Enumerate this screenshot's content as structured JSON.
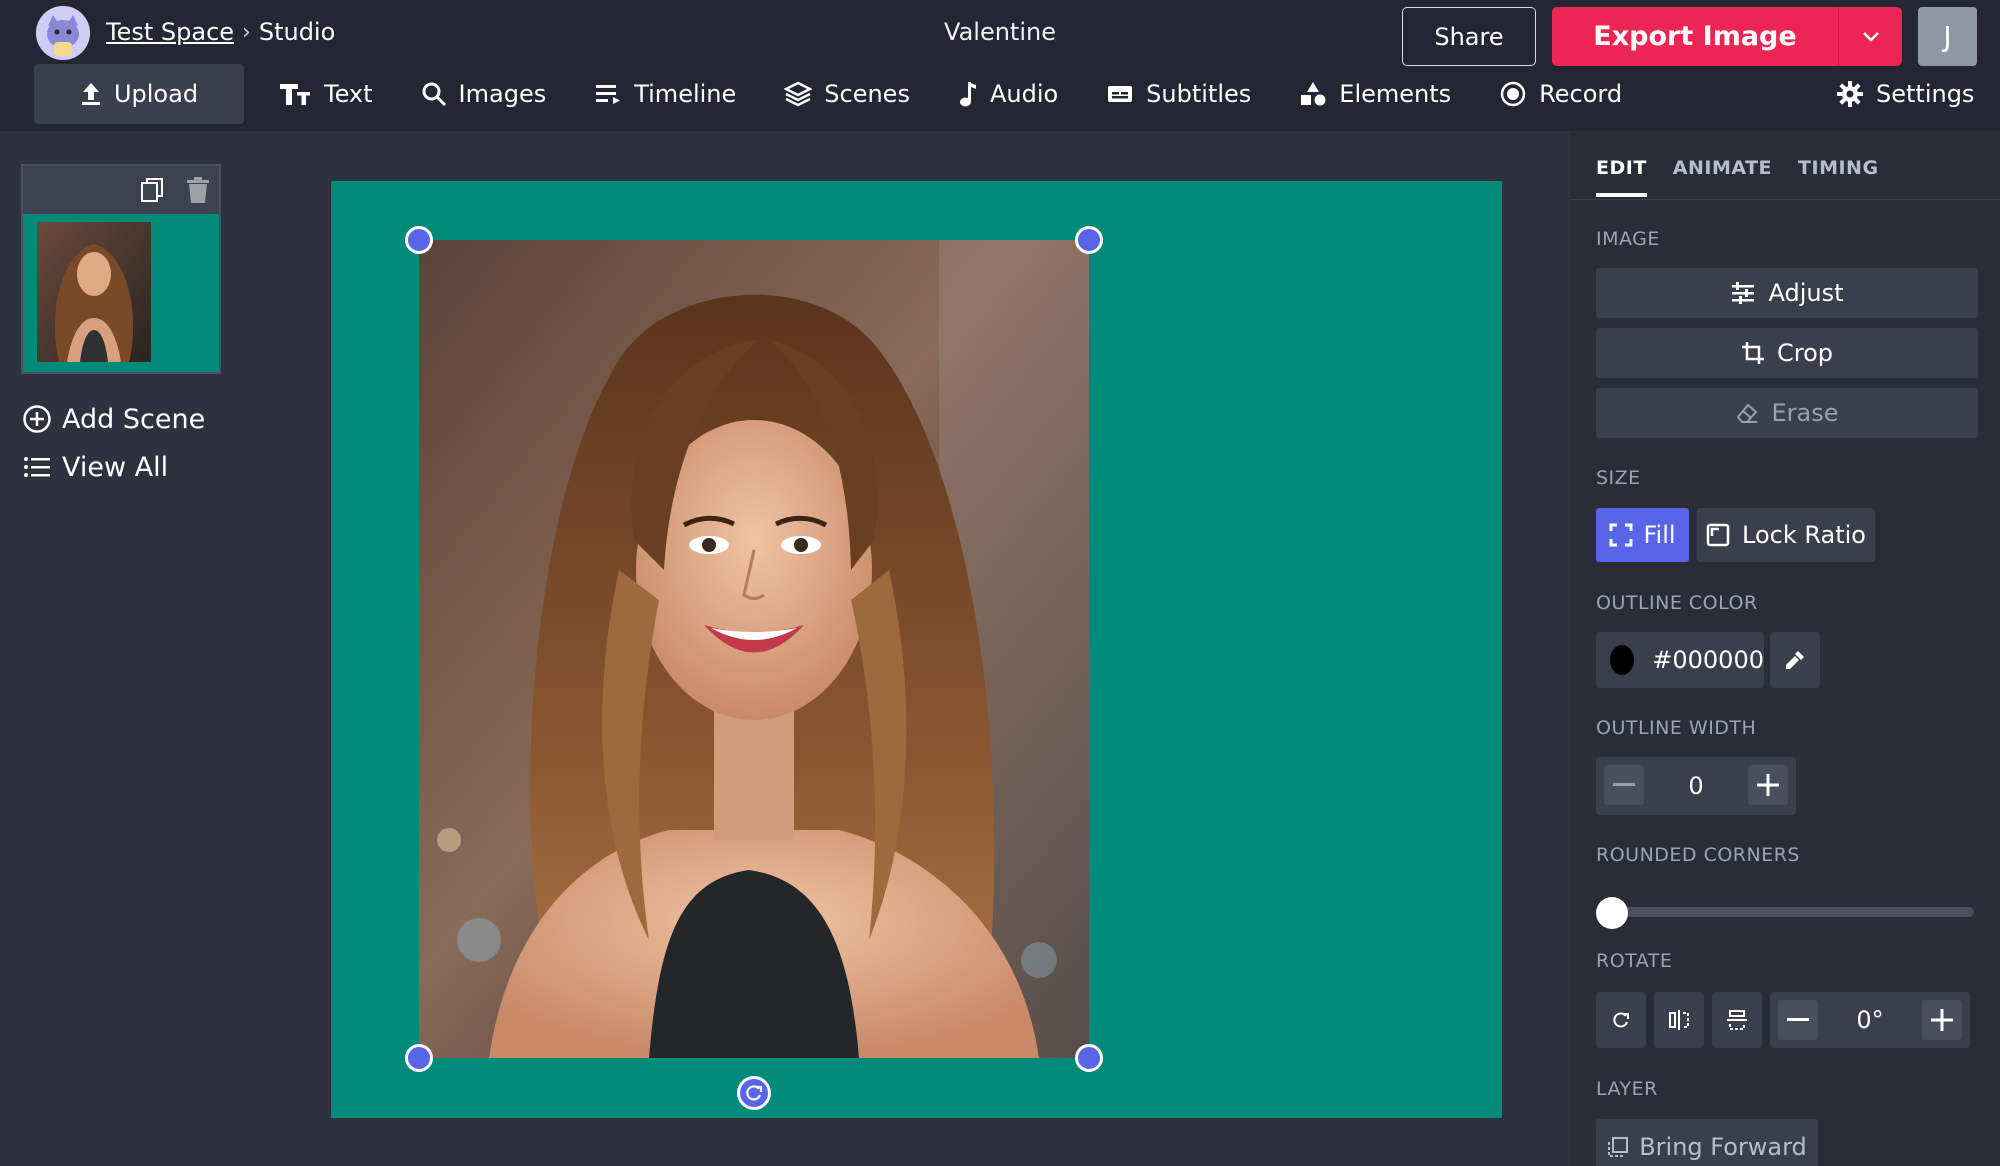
{
  "header": {
    "workspace_link": "Test Space",
    "separator": "›",
    "section": "Studio",
    "project_title": "Valentine",
    "share_label": "Share",
    "export_label": "Export Image",
    "user_initial": "J"
  },
  "nav": {
    "upload": "Upload",
    "text": "Text",
    "images": "Images",
    "timeline": "Timeline",
    "scenes": "Scenes",
    "audio": "Audio",
    "subtitles": "Subtitles",
    "elements": "Elements",
    "record": "Record",
    "settings": "Settings"
  },
  "scenes_panel": {
    "add_scene": "Add Scene",
    "view_all": "View All"
  },
  "canvas": {
    "background_color": "#008a7a"
  },
  "properties": {
    "tabs": [
      "EDIT",
      "ANIMATE",
      "TIMING"
    ],
    "active_tab": "EDIT",
    "image_section": "IMAGE",
    "adjust": "Adjust",
    "crop": "Crop",
    "erase": "Erase",
    "size_section": "SIZE",
    "fill": "Fill",
    "lock_ratio": "Lock Ratio",
    "outline_color_section": "OUTLINE COLOR",
    "outline_color_value": "#000000",
    "outline_width_section": "OUTLINE WIDTH",
    "outline_width_value": "0",
    "rounded_corners_section": "ROUNDED CORNERS",
    "rounded_corners_value": 0,
    "rotate_section": "ROTATE",
    "rotate_value": "0°",
    "layer_section": "LAYER",
    "bring_forward": "Bring Forward"
  },
  "colors": {
    "accent": "#5865e6",
    "export": "#ec2553",
    "topbar": "#242633",
    "panel": "#2a2c38"
  }
}
